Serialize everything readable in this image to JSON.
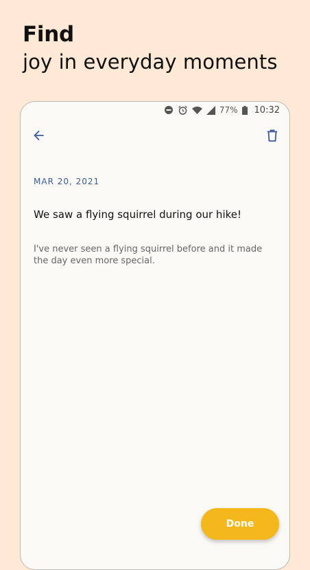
{
  "promo": {
    "headline_bold": "Find",
    "headline_light": "joy in everyday moments"
  },
  "status_bar": {
    "battery": "77%",
    "time": "10:32"
  },
  "entry": {
    "date": "MAR 20, 2021",
    "title": "We saw a flying squirrel during our hike!",
    "body": "I've never seen a flying squirrel before and it made the day even more special."
  },
  "actions": {
    "done_label": "Done"
  },
  "icons": {
    "back": "arrow-back-icon",
    "delete": "trash-icon",
    "dnd": "do-not-disturb-icon",
    "alarm": "alarm-icon",
    "wifi": "wifi-icon",
    "signal": "signal-icon",
    "battery": "battery-icon"
  },
  "colors": {
    "background": "#fde9d5",
    "accent": "#f4b81c",
    "date_blue": "#3a5a9b"
  }
}
